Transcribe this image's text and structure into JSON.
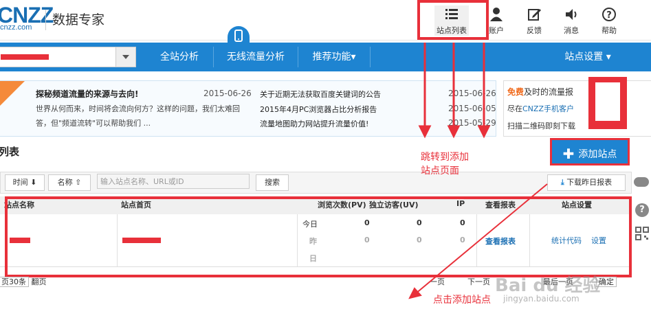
{
  "header": {
    "logo": "CNZZ",
    "logo_sub": "cnzz.com",
    "brand": "数据专家",
    "buttons": [
      {
        "label": "站点列表",
        "icon": "list-icon"
      },
      {
        "label": "账户",
        "icon": "user-icon"
      },
      {
        "label": "反馈",
        "icon": "edit-icon"
      },
      {
        "label": "消息",
        "icon": "speaker-icon"
      },
      {
        "label": "帮助",
        "icon": "help-icon"
      }
    ]
  },
  "nav": {
    "items": [
      "全站分析",
      "无线流量分析",
      "推荐功能▾"
    ],
    "settings": "站点设置 ▾"
  },
  "notice": {
    "title": "探秘频道流量的来源与去向!",
    "title_date": "2015-06-26",
    "body": "世界从何而来，时间将会流向何方？这样的问题，我们太难回答，但\"频道流转\"可以帮助我们 ...",
    "links": [
      {
        "text": "关于近期无法获取百度关键词的公告",
        "date": "2015-06-26"
      },
      {
        "text": "2015年4月PC浏览器占比分析报告",
        "date": "2015-06-05"
      },
      {
        "text": "流量地图助力网站提升流量价值!",
        "date": "2015-05-29"
      }
    ]
  },
  "promo": {
    "free": "免费",
    "line1": "及时的流量报",
    "line2a": "尽在",
    "line2b": "CNZZ手机客户",
    "line3": "扫描二维码即刻下载"
  },
  "list": {
    "title": "列表",
    "add_button": "添加站点",
    "sort_time": "时间 ⬇",
    "sort_name": "名称 ⇧",
    "search_placeholder": "输入站点名称、URL或ID",
    "search_button": "搜索",
    "download_button": "下载昨日报表",
    "columns": [
      "站点名称",
      "站点首页",
      "浏览次数(PV)",
      "独立访客(UV)",
      "IP",
      "查看报表",
      "站点设置"
    ],
    "row": {
      "today": "今日",
      "yesterday_1": "昨",
      "yesterday_2": "日",
      "pv_today": "0",
      "uv_today": "0",
      "ip_today": "0",
      "pv_yest": "0",
      "uv_yest": "0",
      "ip_yest": "0",
      "report_link": "查看报表",
      "code_link": "统计代码",
      "settings_link": "设置"
    },
    "pager": {
      "per_page": "页30条",
      "flip": "翻页",
      "prev": "一页",
      "next": "下一页",
      "last": "最后一页",
      "go": "确定"
    }
  },
  "annotations": {
    "jump_1": "跳转到添加",
    "jump_2": "站点页面",
    "click_add": "点击添加站点"
  },
  "watermark": {
    "main": "Bai du 经验",
    "sub": "jingyan.baidu.com"
  },
  "colors": {
    "accent": "#1e84d1",
    "annotation": "#e8303a",
    "brand": "#1a6fb3"
  }
}
